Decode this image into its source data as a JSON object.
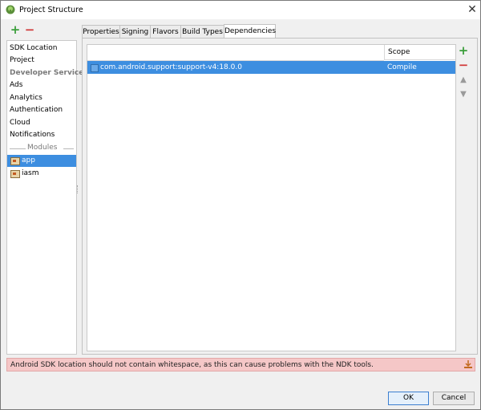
{
  "window": {
    "title": "Project Structure"
  },
  "sidebar": {
    "items": [
      {
        "label": "SDK Location",
        "kind": "item"
      },
      {
        "label": "Project",
        "kind": "item"
      },
      {
        "label": "Developer Services",
        "kind": "header"
      },
      {
        "label": "Ads",
        "kind": "item"
      },
      {
        "label": "Analytics",
        "kind": "item"
      },
      {
        "label": "Authentication",
        "kind": "item"
      },
      {
        "label": "Cloud",
        "kind": "item"
      },
      {
        "label": "Notifications",
        "kind": "item"
      }
    ],
    "modules_label": "Modules",
    "modules": [
      {
        "label": "app",
        "selected": true
      },
      {
        "label": "iasm",
        "selected": false
      }
    ]
  },
  "tabs": [
    {
      "label": "Properties",
      "active": false
    },
    {
      "label": "Signing",
      "active": false
    },
    {
      "label": "Flavors",
      "active": false
    },
    {
      "label": "Build Types",
      "active": false
    },
    {
      "label": "Dependencies",
      "active": true
    }
  ],
  "dependencies": {
    "columns": {
      "dependency": "",
      "scope": "Scope"
    },
    "rows": [
      {
        "dependency": "com.android.support:support-v4:18.0.0",
        "scope": "Compile",
        "selected": true
      }
    ]
  },
  "warning": {
    "text": "Android SDK location should not contain whitespace, as this can cause problems with the NDK tools."
  },
  "buttons": {
    "ok": "OK",
    "cancel": "Cancel"
  },
  "icons": {
    "add": "plus-icon",
    "remove": "minus-icon",
    "up": "arrow-up-icon",
    "down": "arrow-down-icon",
    "close": "close-icon",
    "app": "android-icon",
    "fix": "download-icon"
  },
  "colors": {
    "selection": "#3d8ee0",
    "add": "#3b9e3b",
    "remove": "#d13a3a",
    "warning_bg": "#f5c7c7"
  }
}
